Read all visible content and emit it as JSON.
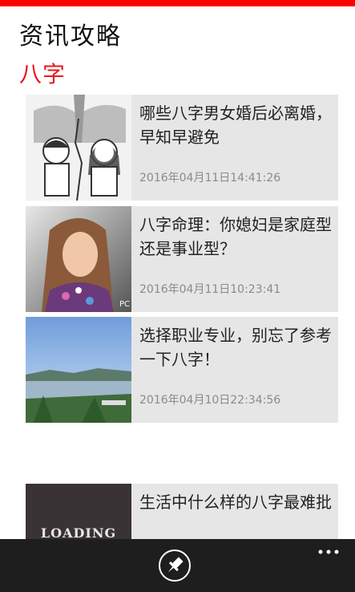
{
  "app": {
    "title": "资讯攻略",
    "section": "八字"
  },
  "articles": [
    {
      "title": "哪些八字男女婚后必离婚，早知早避免",
      "time": "2016年04月11日14:41:26",
      "thumb": "couple-illustration"
    },
    {
      "title": "八字命理：你媳妇是家庭型还是事业型？",
      "time": "2016年04月11日10:23:41",
      "thumb": "girl-photo",
      "thumb_watermark": "PC"
    },
    {
      "title": "选择职业专业，别忘了参考一下八字！",
      "time": "2016年04月10日22:34:56",
      "thumb": "river-landscape"
    },
    {
      "title": "生活中什么样的八字最难批",
      "time": "",
      "thumb": "loading",
      "thumb_text": "LOADING"
    }
  ],
  "appbar": {
    "pin_icon": "pin-icon",
    "more_icon": "more-icon"
  },
  "colors": {
    "accent": "#ff0000",
    "section": "#e8181e",
    "card_bg": "#e6e6e6",
    "appbar_bg": "#1e1e1e"
  }
}
